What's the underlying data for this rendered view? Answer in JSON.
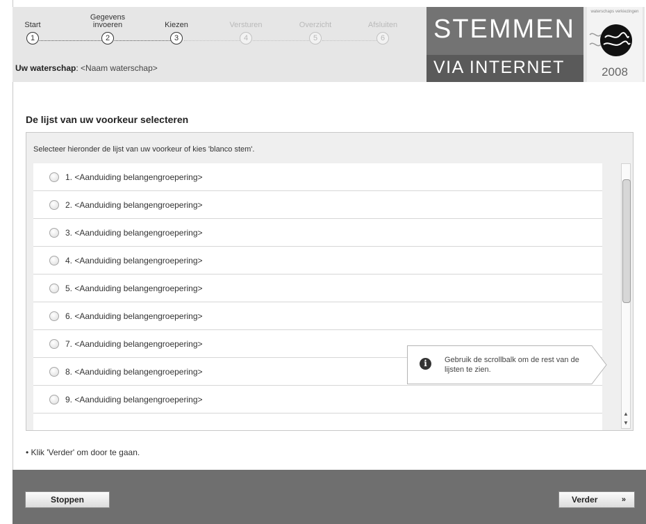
{
  "steps": [
    {
      "label": "Start",
      "num": "1",
      "active": true
    },
    {
      "label": "Gegevens invoeren",
      "num": "2",
      "active": true
    },
    {
      "label": "Kiezen",
      "num": "3",
      "active": true
    },
    {
      "label": "Versturen",
      "num": "4",
      "active": false
    },
    {
      "label": "Overzicht",
      "num": "5",
      "active": false
    },
    {
      "label": "Afsluiten",
      "num": "6",
      "active": false
    }
  ],
  "waterschap": {
    "label": "Uw waterschap",
    "value": "<Naam waterschap>"
  },
  "logo": {
    "line1": "STEMMEN",
    "line2": "VIA INTERNET",
    "year": "2008",
    "seal_text": "waterschaps verkiezingen"
  },
  "page": {
    "title": "De lijst van uw voorkeur selecteren",
    "instruction": "Selecteer hieronder de lijst van uw voorkeur of kies 'blanco stem'.",
    "hint": "• Klik 'Verder' om door te gaan."
  },
  "list_items": [
    "1. <Aanduiding belangengroepering>",
    "2. <Aanduiding belangengroepering>",
    "3. <Aanduiding belangengroepering>",
    "4. <Aanduiding belangengroepering>",
    "5. <Aanduiding belangengroepering>",
    "6. <Aanduiding belangengroepering>",
    "7. <Aanduiding belangengroepering>",
    "8. <Aanduiding belangengroepering>",
    "9. <Aanduiding belangengroepering>"
  ],
  "tooltip": {
    "text": "Gebruik de scrollbalk om de rest van de lijsten te zien.",
    "icon": "info-icon"
  },
  "buttons": {
    "stop": "Stoppen",
    "next": "Verder",
    "next_icon": "»"
  },
  "colors": {
    "header_bg": "#e6e6e6",
    "logo_bg": "#737373",
    "footer_bg": "#6f6f6f"
  }
}
